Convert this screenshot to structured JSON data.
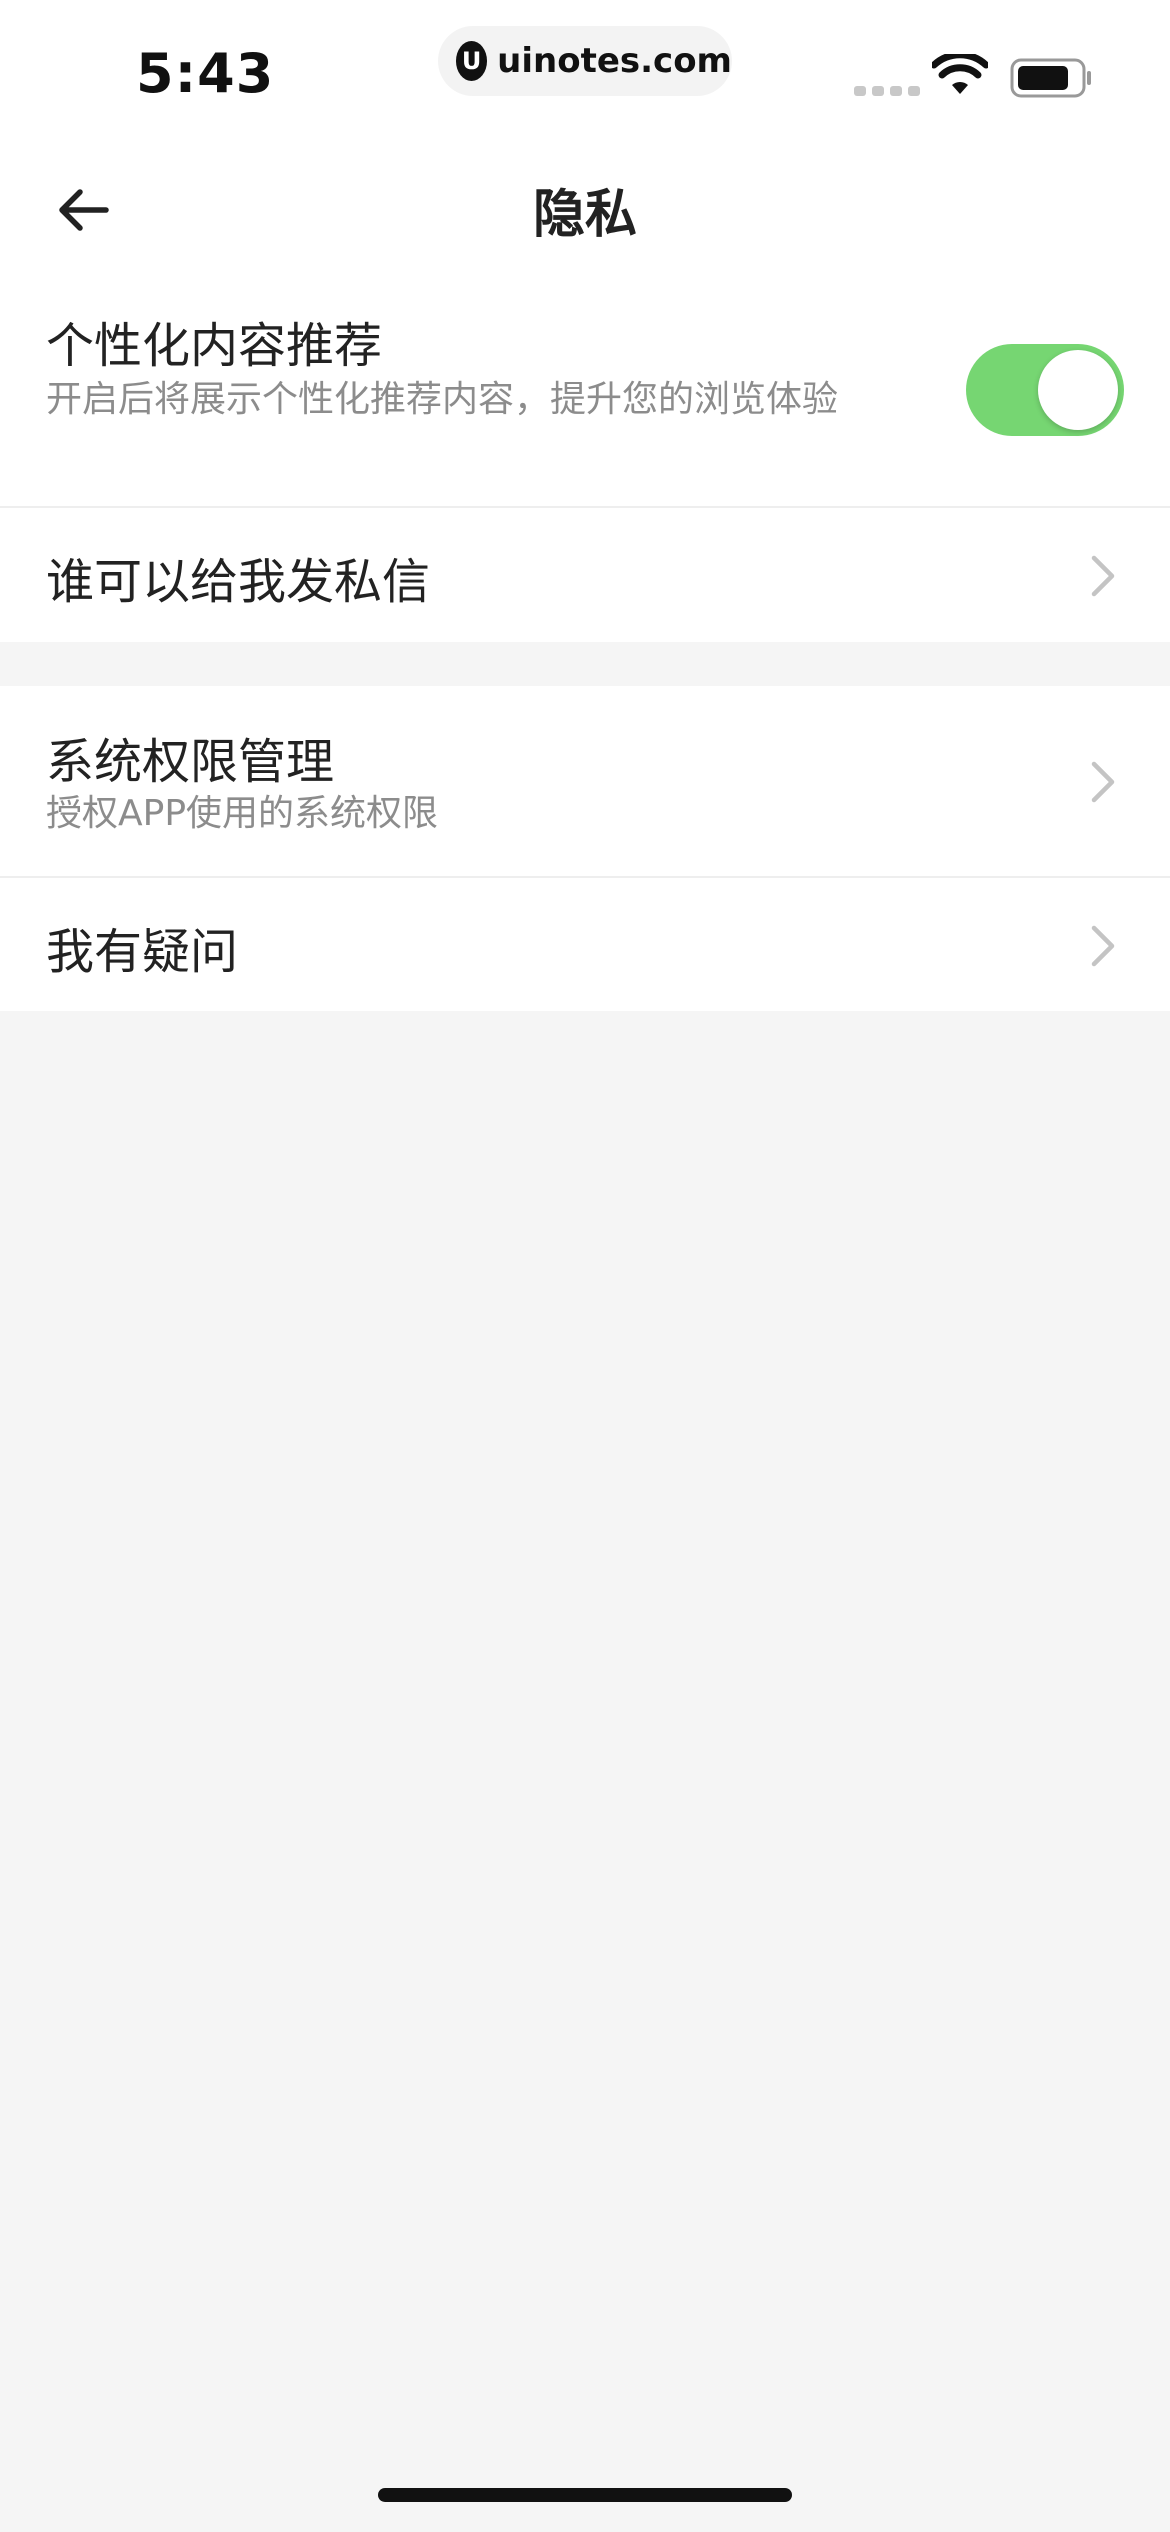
{
  "status_bar": {
    "time": "5:43",
    "url": "uinotes.com",
    "url_logo_glyph": "U"
  },
  "nav": {
    "title": "隐私"
  },
  "settings": {
    "personalized": {
      "title": "个性化内容推荐",
      "subtitle": "开启后将展示个性化推荐内容，提升您的浏览体验",
      "enabled": true
    },
    "private_message": {
      "title": "谁可以给我发私信"
    },
    "system_permissions": {
      "title": "系统权限管理",
      "subtitle": "授权APP使用的系统权限"
    },
    "faq": {
      "title": "我有疑问"
    }
  },
  "colors": {
    "toggle_on": "#76d672",
    "background": "#f5f5f5",
    "subtitle": "#8c8c8c"
  }
}
